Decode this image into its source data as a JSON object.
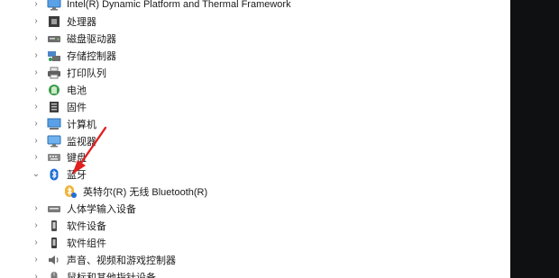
{
  "device_tree": {
    "items": [
      {
        "label": "Intel(R) Dynamic Platform and Thermal Framework",
        "expanded": false,
        "icon": "monitor-icon"
      },
      {
        "label": "处理器",
        "expanded": false,
        "icon": "processor-icon"
      },
      {
        "label": "磁盘驱动器",
        "expanded": false,
        "icon": "disk-icon"
      },
      {
        "label": "存储控制器",
        "expanded": false,
        "icon": "storage-controller-icon"
      },
      {
        "label": "打印队列",
        "expanded": false,
        "icon": "printer-icon"
      },
      {
        "label": "电池",
        "expanded": false,
        "icon": "battery-icon"
      },
      {
        "label": "固件",
        "expanded": false,
        "icon": "firmware-icon"
      },
      {
        "label": "计算机",
        "expanded": false,
        "icon": "computer-icon"
      },
      {
        "label": "监视器",
        "expanded": false,
        "icon": "monitor-icon"
      },
      {
        "label": "键盘",
        "expanded": false,
        "icon": "keyboard-icon"
      },
      {
        "label": "蓝牙",
        "expanded": true,
        "icon": "bluetooth-icon",
        "children": [
          {
            "label": "英特尔(R) 无线 Bluetooth(R)",
            "icon": "bluetooth-device-icon"
          }
        ]
      },
      {
        "label": "人体学输入设备",
        "expanded": false,
        "icon": "hid-icon"
      },
      {
        "label": "软件设备",
        "expanded": false,
        "icon": "software-device-icon"
      },
      {
        "label": "软件组件",
        "expanded": false,
        "icon": "software-component-icon"
      },
      {
        "label": "声音、视频和游戏控制器",
        "expanded": false,
        "icon": "sound-icon"
      },
      {
        "label": "鼠标和其他指针设备",
        "expanded": false,
        "icon": "mouse-icon"
      }
    ]
  },
  "colors": {
    "panel_bg": "#ffffff",
    "outer_bg": "#0f1012",
    "annotation_arrow": "#e02020",
    "bluetooth_blue": "#1f6fd6"
  }
}
